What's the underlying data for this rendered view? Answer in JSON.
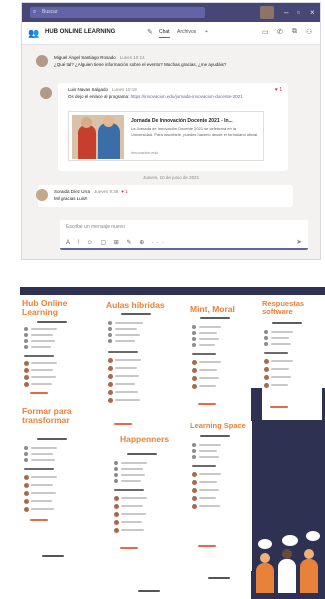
{
  "teams": {
    "search_placeholder": "Buscar",
    "chat_title": "HUB ONLINE LEARNING",
    "tabs": [
      "Chat",
      "Archivos",
      "+"
    ],
    "messages": [
      {
        "author": "Miguel Ángel Santiago Rosado",
        "time": "Lunes 10:14",
        "text": "¿Qué tal? ¿Alguien tiene información sobre el evento? Muchas gracias, ¿me ayudáis?"
      },
      {
        "author": "Luis Navas Salgado",
        "time": "Lunes 10:19",
        "text": "Os dejo el enlace al programa:",
        "link": "https://innovacion.edu/jornada-innovacion-docente-2021",
        "reaction": "1",
        "card": {
          "title": "Jornada De Innovación Docente 2021 - In...",
          "description": "La Jornada de Innovación Docente 2021 se celebrará en la Universidad. Para inscribirte, puedes hacerlo desde el formulario oficial.",
          "url": "innovacion.edu"
        }
      },
      {
        "author": "Soraida Díez Urra",
        "time": "Jueves 9:38",
        "text": "Mil gracias Luis!!",
        "reaction": "1"
      }
    ],
    "day_separator": "Jueves, 10 de junio de 2021",
    "compose_placeholder": "Escribe un mensaje nuevo",
    "compose_tools": "A ! ☺ ▢ ⊞ ✎ ⊕ ···",
    "send_icon": "➤"
  },
  "collage": {
    "panels": [
      {
        "title": "Hub Online Learning"
      },
      {
        "title": "Aulas híbridas"
      },
      {
        "title": "Mint, Moral"
      },
      {
        "title": "Respuestas software"
      },
      {
        "title": "Formar para transformar"
      },
      {
        "title": "Happenners"
      },
      {
        "title": "Learning Space"
      }
    ]
  },
  "colors": {
    "teams_purple": "#464775",
    "accent": "#6264a7",
    "orange": "#e8823b",
    "navy": "#2f3152"
  }
}
